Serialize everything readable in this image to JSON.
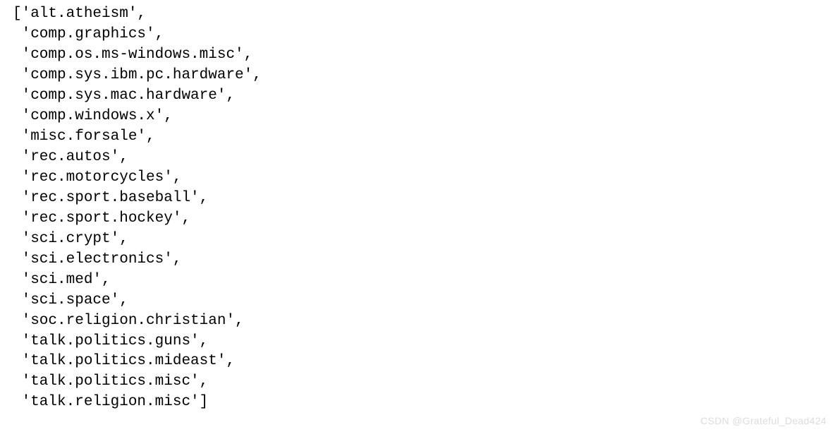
{
  "list_items": [
    "alt.atheism",
    "comp.graphics",
    "comp.os.ms-windows.misc",
    "comp.sys.ibm.pc.hardware",
    "comp.sys.mac.hardware",
    "comp.windows.x",
    "misc.forsale",
    "rec.autos",
    "rec.motorcycles",
    "rec.sport.baseball",
    "rec.sport.hockey",
    "sci.crypt",
    "sci.electronics",
    "sci.med",
    "sci.space",
    "soc.religion.christian",
    "talk.politics.guns",
    "talk.politics.mideast",
    "talk.politics.misc",
    "talk.religion.misc"
  ],
  "watermark": "CSDN @Grateful_Dead424"
}
